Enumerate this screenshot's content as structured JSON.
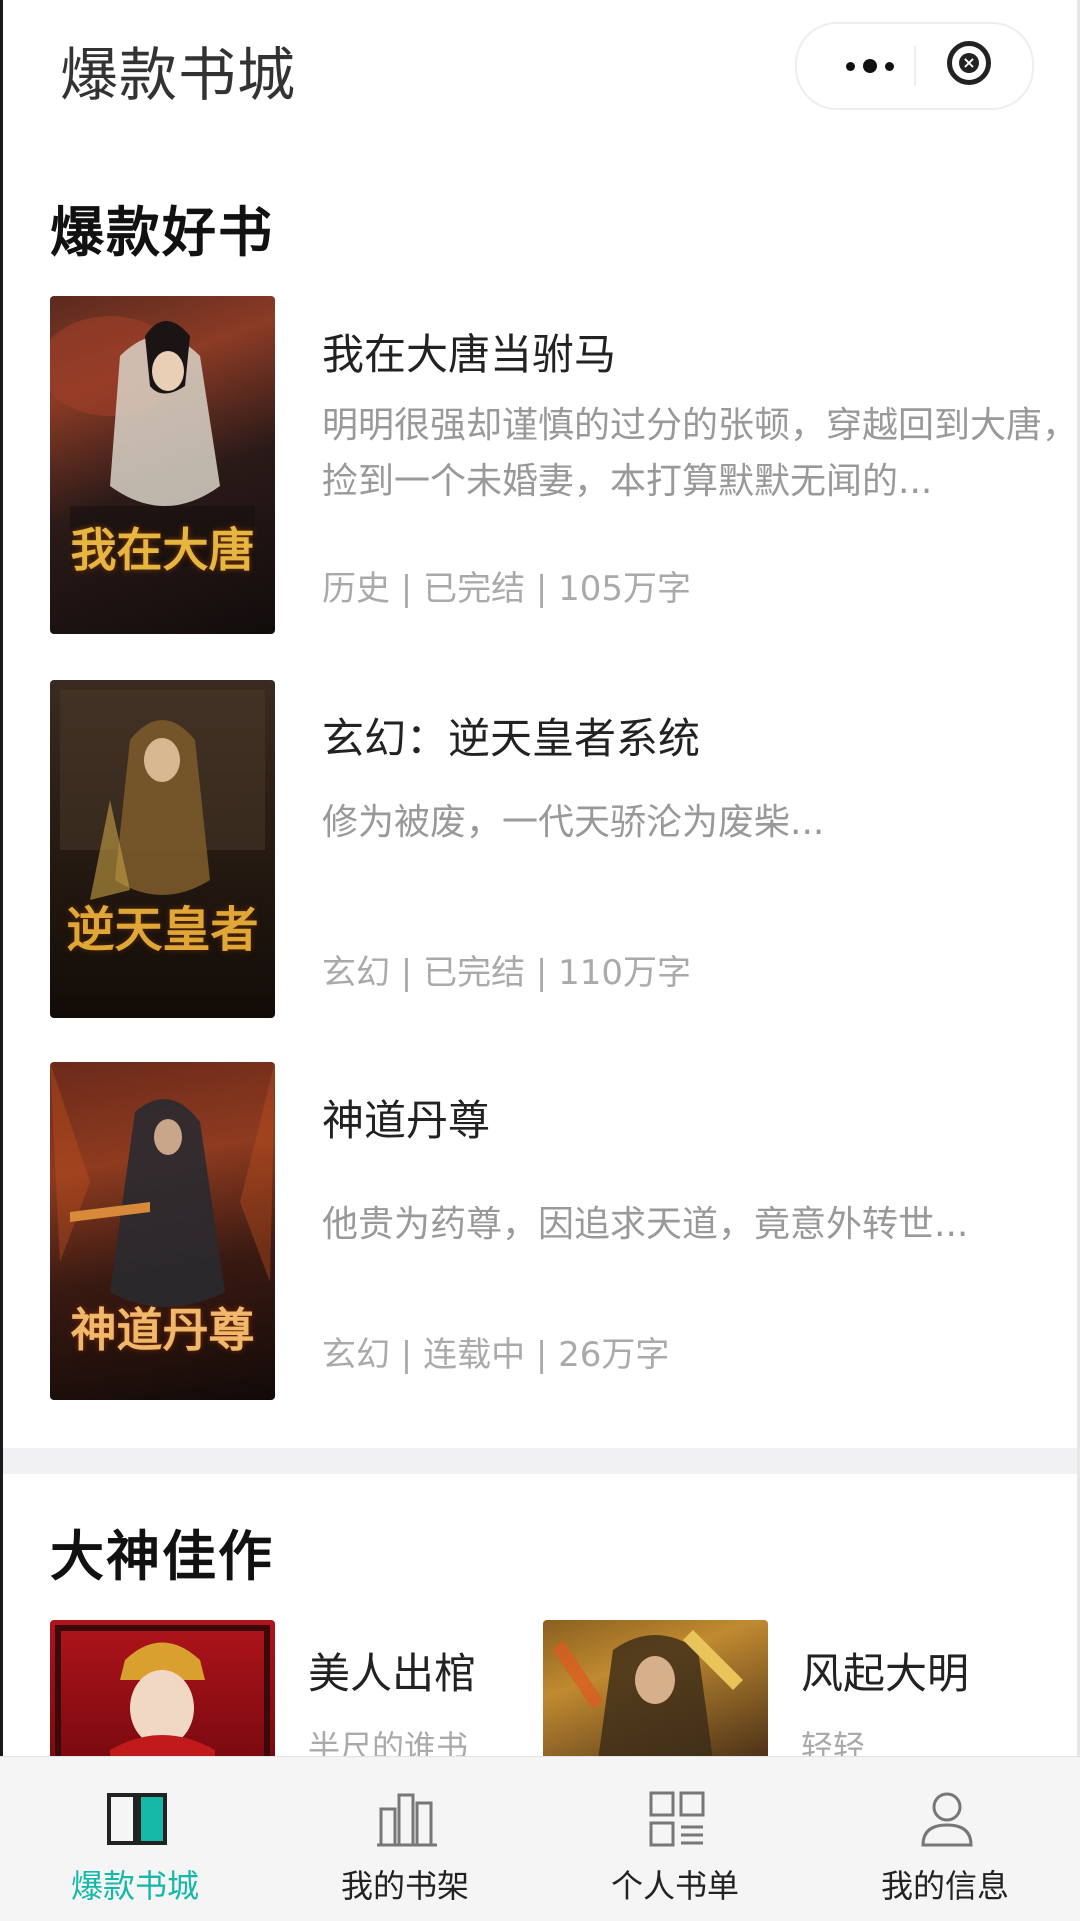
{
  "header": {
    "title": "爆款书城",
    "more_icon": "more-dots-icon",
    "close_icon": "close-circle-icon"
  },
  "hot_section": {
    "title": "爆款好书",
    "books": [
      {
        "name": "我在大唐当驸马",
        "desc": "明明很强却谨慎的过分的张顿，穿越回到大唐，捡到一个未婚妻，本打算默默无闻的...",
        "meta": "历史 | 已完结 | 105万字",
        "cover_text": "我在大唐"
      },
      {
        "name": "玄幻：逆天皇者系统",
        "desc": "修为被废，一代天骄沦为废柴...",
        "meta": "玄幻 | 已完结 | 110万字",
        "cover_text": "逆天皇者"
      },
      {
        "name": "神道丹尊",
        "desc": "他贵为药尊，因追求天道，竟意外转世...",
        "meta": "玄幻 | 连载中 | 26万字",
        "cover_text": "神道丹尊"
      }
    ]
  },
  "master_section": {
    "title": "大神佳作",
    "books": [
      {
        "name": "美人出棺",
        "author": "半尺的谁书"
      },
      {
        "name": "风起大明",
        "author": "轻轻"
      }
    ]
  },
  "tabbar": {
    "tabs": [
      {
        "label": "爆款书城",
        "icon": "open-book-icon",
        "active": true
      },
      {
        "label": "我的书架",
        "icon": "bookshelf-icon",
        "active": false
      },
      {
        "label": "个人书单",
        "icon": "grid-list-icon",
        "active": false
      },
      {
        "label": "我的信息",
        "icon": "user-icon",
        "active": false
      }
    ],
    "active_color": "#16b8a8"
  }
}
